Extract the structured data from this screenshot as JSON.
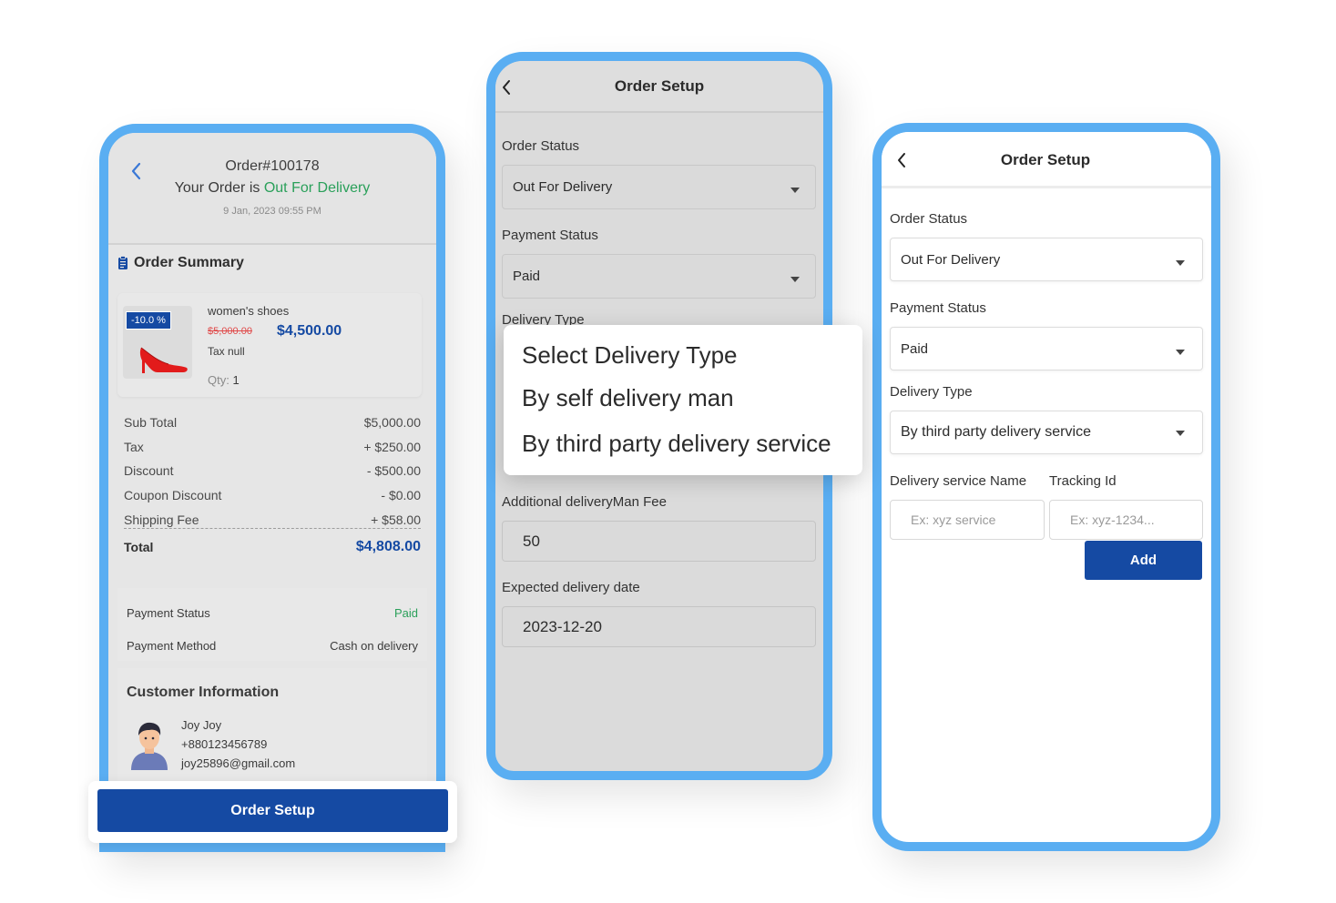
{
  "colors": {
    "frame": "#5aaef2",
    "primary": "#154aa3",
    "success": "#2aa05a",
    "strike": "#e04a4a"
  },
  "order_details": {
    "order_number": "Order#100178",
    "status_prefix": "Your Order is",
    "status_value": "Out For Delivery",
    "date": "9 Jan, 2023 09:55 PM",
    "summary_title": "Order Summary",
    "product": {
      "name": "women's shoes",
      "discount_badge": "-10.0 %",
      "old_price": "$5,000.00",
      "new_price": "$4,500.00",
      "tax": "Tax null",
      "qty_label": "Qty:",
      "qty_value": "1",
      "image_icon": "red-heel-shoe-icon"
    },
    "price_rows": [
      {
        "label": "Sub Total",
        "value": "$5,000.00"
      },
      {
        "label": "Tax",
        "value": "+ $250.00"
      },
      {
        "label": "Discount",
        "value": "- $500.00"
      },
      {
        "label": "Coupon Discount",
        "value": "- $0.00"
      },
      {
        "label": "Shipping Fee",
        "value": "+ $58.00"
      }
    ],
    "total_label": "Total",
    "total_value": "$4,808.00",
    "payment_status_label": "Payment Status",
    "payment_status_value": "Paid",
    "payment_method_label": "Payment Method",
    "payment_method_value": "Cash on delivery",
    "customer_title": "Customer Information",
    "customer_name": "Joy Joy",
    "customer_phone": "+880123456789",
    "customer_email": "joy25896@gmail.com",
    "order_setup_button": "Order Setup"
  },
  "setup_dialog": {
    "title": "Order Setup",
    "order_status_label": "Order Status",
    "order_status_value": "Out For Delivery",
    "payment_status_label": "Payment Status",
    "payment_status_value": "Paid",
    "delivery_type_label": "Delivery Type",
    "additional_fee_label": "Additional deliveryMan Fee",
    "additional_fee_value": "50",
    "expected_date_label": "Expected delivery date",
    "expected_date_value": "2023-12-20",
    "popup_options": [
      "Select Delivery Type",
      "By self delivery man",
      "By third party delivery service"
    ]
  },
  "setup_third_party": {
    "title": "Order Setup",
    "order_status_label": "Order Status",
    "order_status_value": "Out For Delivery",
    "payment_status_label": "Payment Status",
    "payment_status_value": "Paid",
    "delivery_type_label": "Delivery Type",
    "delivery_type_value": "By third party delivery service",
    "service_name_label": "Delivery service Name",
    "service_name_placeholder": "Ex: xyz service",
    "tracking_label": "Tracking Id",
    "tracking_placeholder": "Ex: xyz-1234...",
    "add_button": "Add"
  }
}
